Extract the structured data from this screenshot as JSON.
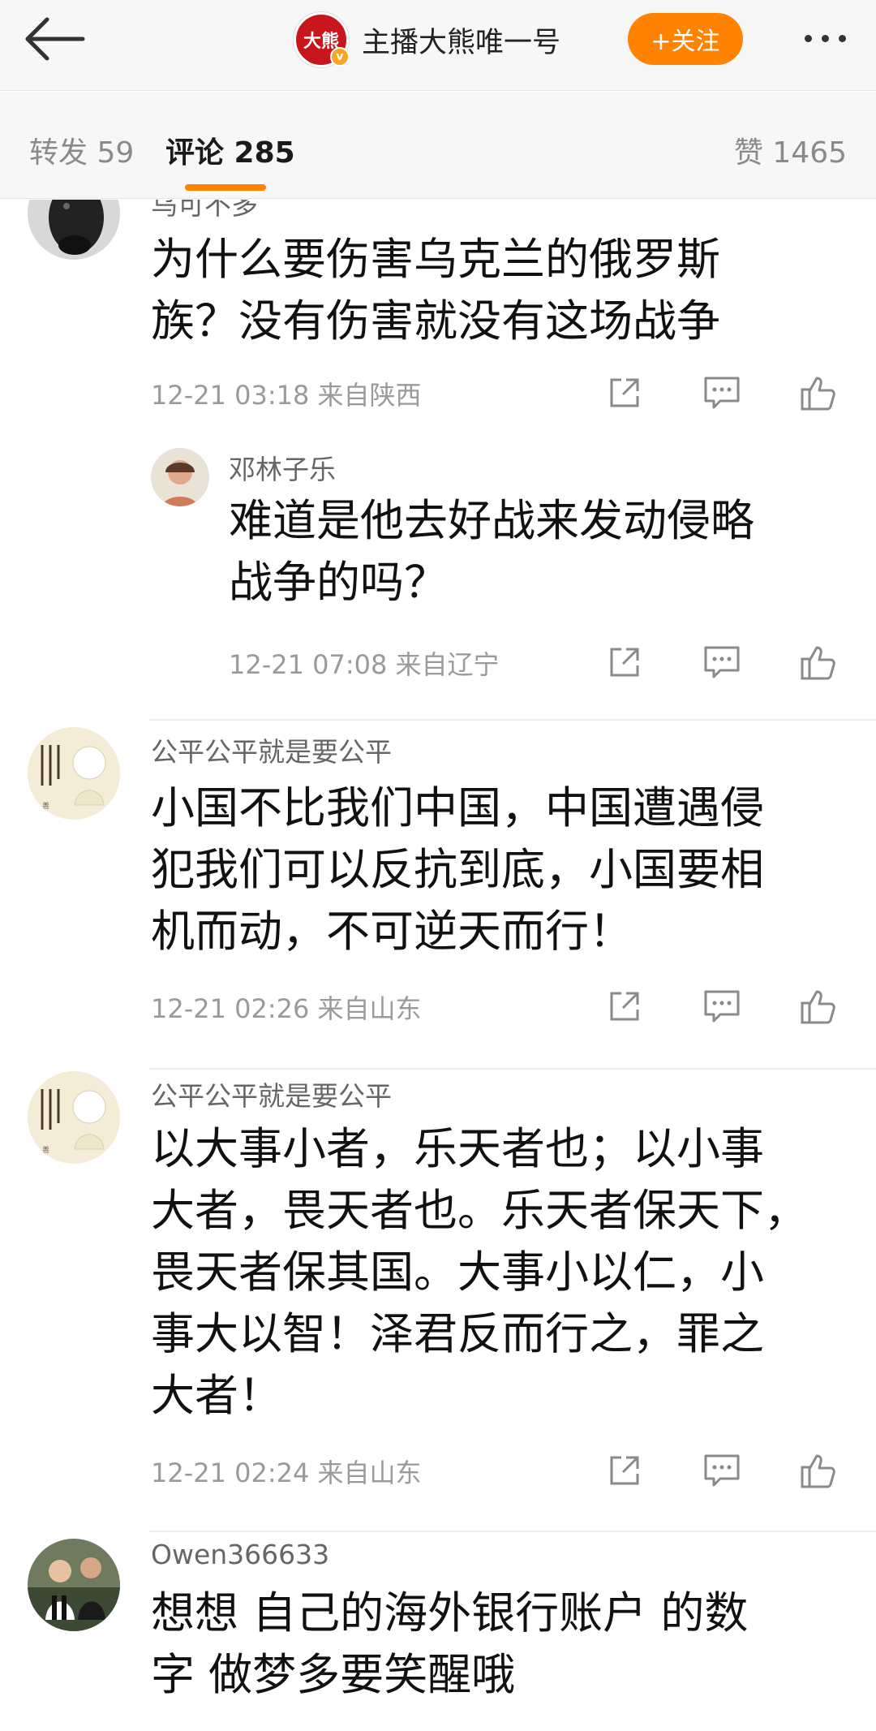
{
  "header": {
    "account_name": "主播大熊唯一号",
    "logo_text": "大熊",
    "verify_badge": "v",
    "follow_label": "+关注"
  },
  "tabs": {
    "reposts": "转发 59",
    "comments": "评论 285",
    "likes": "赞 1465"
  },
  "comments": [
    {
      "username": "乌可不多",
      "text_lines": [
        "为什么要伤害乌克兰的俄罗斯",
        "族？没有伤害就没有这场战争"
      ],
      "time": "12-21 03:18",
      "location": "来自陕西"
    },
    {
      "username": "邓林子乐",
      "text_lines": [
        "难道是他去好战来发动侵略",
        "战争的吗？"
      ],
      "time": "12-21 07:08",
      "location": "来自辽宁"
    },
    {
      "username": "公平公平就是要公平",
      "text_lines": [
        "小国不比我们中国，中国遭遇侵",
        "犯我们可以反抗到底，小国要相",
        "机而动，不可逆天而行！"
      ],
      "time": "12-21 02:26",
      "location": "来自山东"
    },
    {
      "username": "公平公平就是要公平",
      "text_lines": [
        "以大事小者，乐天者也；以小事",
        "大者，畏天者也。乐天者保天下，",
        "畏天者保其国。大事小以仁，小",
        "事大以智！泽君反而行之，罪之",
        "大者！"
      ],
      "time": "12-21 02:24",
      "location": "来自山东"
    },
    {
      "username": "Owen366633",
      "text_lines": [
        "想想 自己的海外银行账户 的数",
        "字 做梦多要笑醒哦"
      ],
      "time": "",
      "location": ""
    }
  ],
  "colors": {
    "accent": "#ff8200",
    "meta": "#9a9a9a",
    "icon": "#8a8a8a"
  }
}
